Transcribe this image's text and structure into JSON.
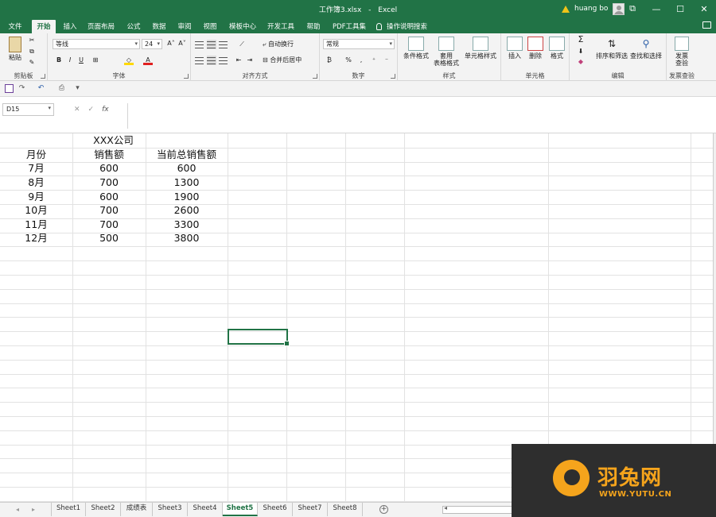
{
  "window": {
    "title_file": "工作簿3.xlsx",
    "title_sep": "-",
    "title_app": "Excel",
    "user_name": "huang bo",
    "minimize": "—",
    "maximize": "☐",
    "close": "✕",
    "restore": "⧉"
  },
  "tabs": [
    "文件",
    "开始",
    "插入",
    "页面布局",
    "公式",
    "数据",
    "审阅",
    "视图",
    "模板中心",
    "开发工具",
    "帮助",
    "PDF工具集"
  ],
  "active_tab": "开始",
  "tell_me": "操作说明搜索",
  "ribbon": {
    "clipboard": {
      "paste": "粘贴",
      "label": "剪贴板"
    },
    "font": {
      "name": "等线",
      "size": "24",
      "bold": "B",
      "italic": "I",
      "underline": "U",
      "grow": "A˄",
      "shrink": "A˅",
      "label": "字体"
    },
    "alignment": {
      "wrap": "自动换行",
      "merge": "合并后居中",
      "label": "对齐方式"
    },
    "number": {
      "format": "常规",
      "percent": "%",
      "comma": ",",
      "label": "数字"
    },
    "styles": {
      "conditional": "条件格式",
      "table1": "套用",
      "table2": "表格格式",
      "cell_styles": "单元格样式",
      "label": "样式"
    },
    "cells": {
      "insert": "插入",
      "delete": "删除",
      "format": "格式",
      "label": "单元格"
    },
    "editing": {
      "sigma": "Σ",
      "sort": "排序和筛选",
      "find": "查找和选择",
      "label": "编辑"
    },
    "invoice": {
      "line1": "发票",
      "line2": "查验",
      "label": "发票查验"
    }
  },
  "formula_bar": {
    "name_box": "D15",
    "cancel": "✕",
    "enter": "✓",
    "fx": "fx",
    "value": ""
  },
  "sheet": {
    "company": "XXX公司",
    "headers": [
      "月份",
      "销售额",
      "当前总销售额"
    ],
    "rows": [
      [
        "7月",
        "600",
        "600"
      ],
      [
        "8月",
        "700",
        "1300"
      ],
      [
        "9月",
        "600",
        "1900"
      ],
      [
        "10月",
        "700",
        "2600"
      ],
      [
        "11月",
        "700",
        "3300"
      ],
      [
        "12月",
        "500",
        "3800"
      ]
    ]
  },
  "sheet_tabs": [
    "Sheet1",
    "Sheet2",
    "成绩表",
    "Sheet3",
    "Sheet4",
    "Sheet5",
    "Sheet6",
    "Sheet7",
    "Sheet8"
  ],
  "active_sheet": "Sheet5",
  "watermark": {
    "name": "羽兔网",
    "url": "WWW.YUTU.CN"
  },
  "colors": {
    "excel_green": "#217346",
    "watermark_orange": "#f5a41c"
  }
}
